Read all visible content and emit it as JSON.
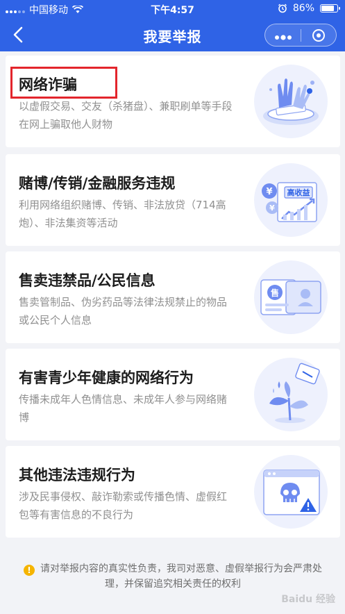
{
  "status_bar": {
    "carrier": "中国移动",
    "time": "下午4:57",
    "battery_percent": "86%",
    "battery_level": 0.86
  },
  "nav": {
    "title": "我要举报",
    "back_icon": "chevron-left-icon",
    "more_icon": "more-dots-icon",
    "close_icon": "target-icon"
  },
  "categories": [
    {
      "title": "网络诈骗",
      "desc": "以虚假交易、交友（杀猪盘）、兼职刷单等手段在网上骗取他人财物",
      "icon": "fraud-hands-illustration",
      "highlighted": true
    },
    {
      "title": "赌博/传销/金融服务违规",
      "desc": "利用网络组织赌博、传销、非法放贷（714高炮）、非法集资等活动",
      "icon": "finance-illustration",
      "badge": "高收益"
    },
    {
      "title": "售卖违禁品/公民信息",
      "desc": "售卖管制品、伪劣药品等法律法规禁止的物品或公民个人信息",
      "icon": "selling-info-illustration",
      "badge": "售"
    },
    {
      "title": "有害青少年健康的网络行为",
      "desc": "传播未成年人色情信息、未成年人参与网络赌博",
      "icon": "youth-plant-illustration"
    },
    {
      "title": "其他违法违规行为",
      "desc": "涉及民事侵权、敲诈勒索或传播色情、虚假红包等有害信息的不良行为",
      "icon": "skull-browser-illustration"
    }
  ],
  "notice": {
    "icon": "warning-icon",
    "text": "请对举报内容的真实性负责，我司对恶意、虚假举报行为会严肃处理，并保留追究相关责任的权利"
  },
  "watermark": "Baidu 经验",
  "colors": {
    "brand_blue": "#2f63e6",
    "highlight_red": "#e3252c",
    "illustration_blue": "#6f8cf0",
    "background": "#f2f3f7"
  }
}
